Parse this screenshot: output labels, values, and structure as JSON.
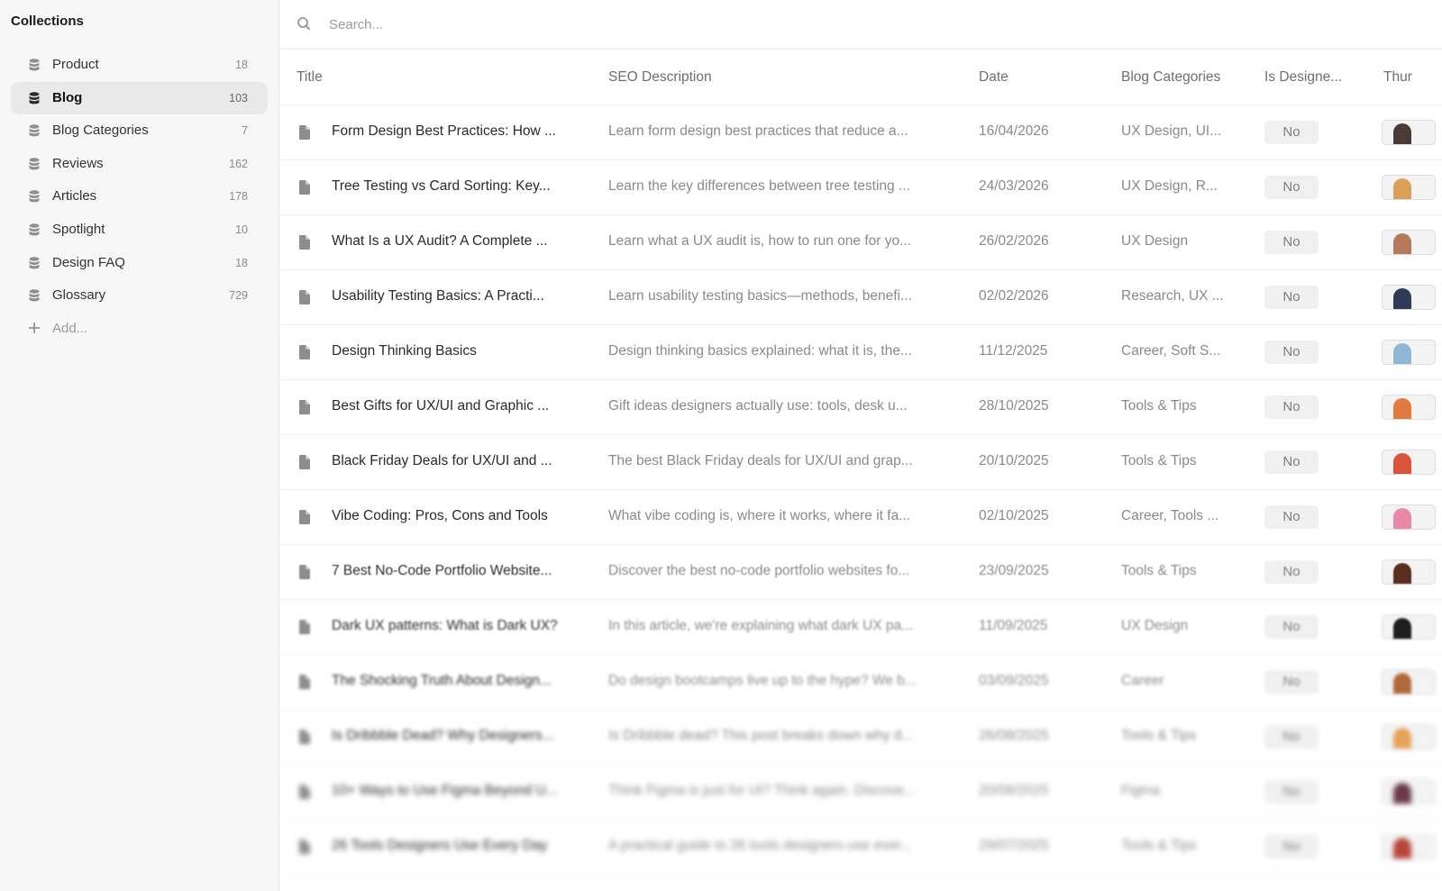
{
  "sidebar": {
    "title": "Collections",
    "items": [
      {
        "label": "Product",
        "count": "18",
        "active": false
      },
      {
        "label": "Blog",
        "count": "103",
        "active": true
      },
      {
        "label": "Blog Categories",
        "count": "7",
        "active": false
      },
      {
        "label": "Reviews",
        "count": "162",
        "active": false
      },
      {
        "label": "Articles",
        "count": "178",
        "active": false
      },
      {
        "label": "Spotlight",
        "count": "10",
        "active": false
      },
      {
        "label": "Design FAQ",
        "count": "18",
        "active": false
      },
      {
        "label": "Glossary",
        "count": "729",
        "active": false
      }
    ],
    "add_label": "Add..."
  },
  "search": {
    "placeholder": "Search..."
  },
  "table": {
    "headers": [
      "Title",
      "SEO Description",
      "Date",
      "Blog Categories",
      "Is Designe...",
      "Thur"
    ],
    "rows": [
      {
        "title": "Form Design Best Practices: How ...",
        "desc": "Learn form design best practices that reduce a...",
        "date": "16/04/2026",
        "category": "UX Design, UI...",
        "is_designer": "No",
        "thumb_color": "#4a3b36"
      },
      {
        "title": "Tree Testing vs Card Sorting: Key...",
        "desc": "Learn the key differences between tree testing ...",
        "date": "24/03/2026",
        "category": "UX Design, R...",
        "is_designer": "No",
        "thumb_color": "#d9a15a"
      },
      {
        "title": "What Is a UX Audit? A Complete ...",
        "desc": "Learn what a UX audit is, how to run one for yo...",
        "date": "26/02/2026",
        "category": "UX Design",
        "is_designer": "No",
        "thumb_color": "#b57a5c"
      },
      {
        "title": "Usability Testing Basics: A Practi...",
        "desc": "Learn usability testing basics—methods, benefi...",
        "date": "02/02/2026",
        "category": "Research, UX ...",
        "is_designer": "No",
        "thumb_color": "#2f3a57"
      },
      {
        "title": "Design Thinking Basics",
        "desc": "Design thinking basics explained: what it is, the...",
        "date": "11/12/2025",
        "category": "Career, Soft S...",
        "is_designer": "No",
        "thumb_color": "#8fb8d6"
      },
      {
        "title": "Best Gifts for UX/UI and Graphic ...",
        "desc": "Gift ideas designers actually use: tools, desk u...",
        "date": "28/10/2025",
        "category": "Tools & Tips",
        "is_designer": "No",
        "thumb_color": "#e07a3f"
      },
      {
        "title": "Black Friday Deals for UX/UI and ...",
        "desc": "The best Black Friday deals for UX/UI and grap...",
        "date": "20/10/2025",
        "category": "Tools & Tips",
        "is_designer": "No",
        "thumb_color": "#d9553a"
      },
      {
        "title": "Vibe Coding: Pros, Cons and Tools",
        "desc": "What vibe coding is, where it works, where it fa...",
        "date": "02/10/2025",
        "category": "Career, Tools ...",
        "is_designer": "No",
        "thumb_color": "#e88aa5"
      },
      {
        "title": "7 Best No-Code Portfolio Website...",
        "desc": "Discover the best no-code portfolio websites fo...",
        "date": "23/09/2025",
        "category": "Tools & Tips",
        "is_designer": "No",
        "thumb_color": "#5a2e1f"
      },
      {
        "title": "Dark UX patterns: What is Dark UX?",
        "desc": "In this article, we're explaining what dark UX pa...",
        "date": "11/09/2025",
        "category": "UX Design",
        "is_designer": "No",
        "thumb_color": "#1e1e1e"
      },
      {
        "title": "The Shocking Truth About Design...",
        "desc": "Do design bootcamps live up to the hype? We b...",
        "date": "03/09/2025",
        "category": "Career",
        "is_designer": "No",
        "thumb_color": "#b06a3a"
      },
      {
        "title": "Is Dribbble Dead? Why Designers...",
        "desc": "Is Dribbble dead? This post breaks down why d...",
        "date": "26/08/2025",
        "category": "Tools & Tips",
        "is_designer": "No",
        "thumb_color": "#e8a35a"
      },
      {
        "title": "10+ Ways to Use Figma Beyond U...",
        "desc": "Think Figma is just for UI? Think again. Discove...",
        "date": "20/08/2025",
        "category": "Figma",
        "is_designer": "No",
        "thumb_color": "#6a3a4a"
      },
      {
        "title": "26 Tools Designers Use Every Day",
        "desc": "A practical guide to 26 tools designers use ever...",
        "date": "29/07/2025",
        "category": "Tools & Tips",
        "is_designer": "No",
        "thumb_color": "#b8453a"
      }
    ]
  }
}
